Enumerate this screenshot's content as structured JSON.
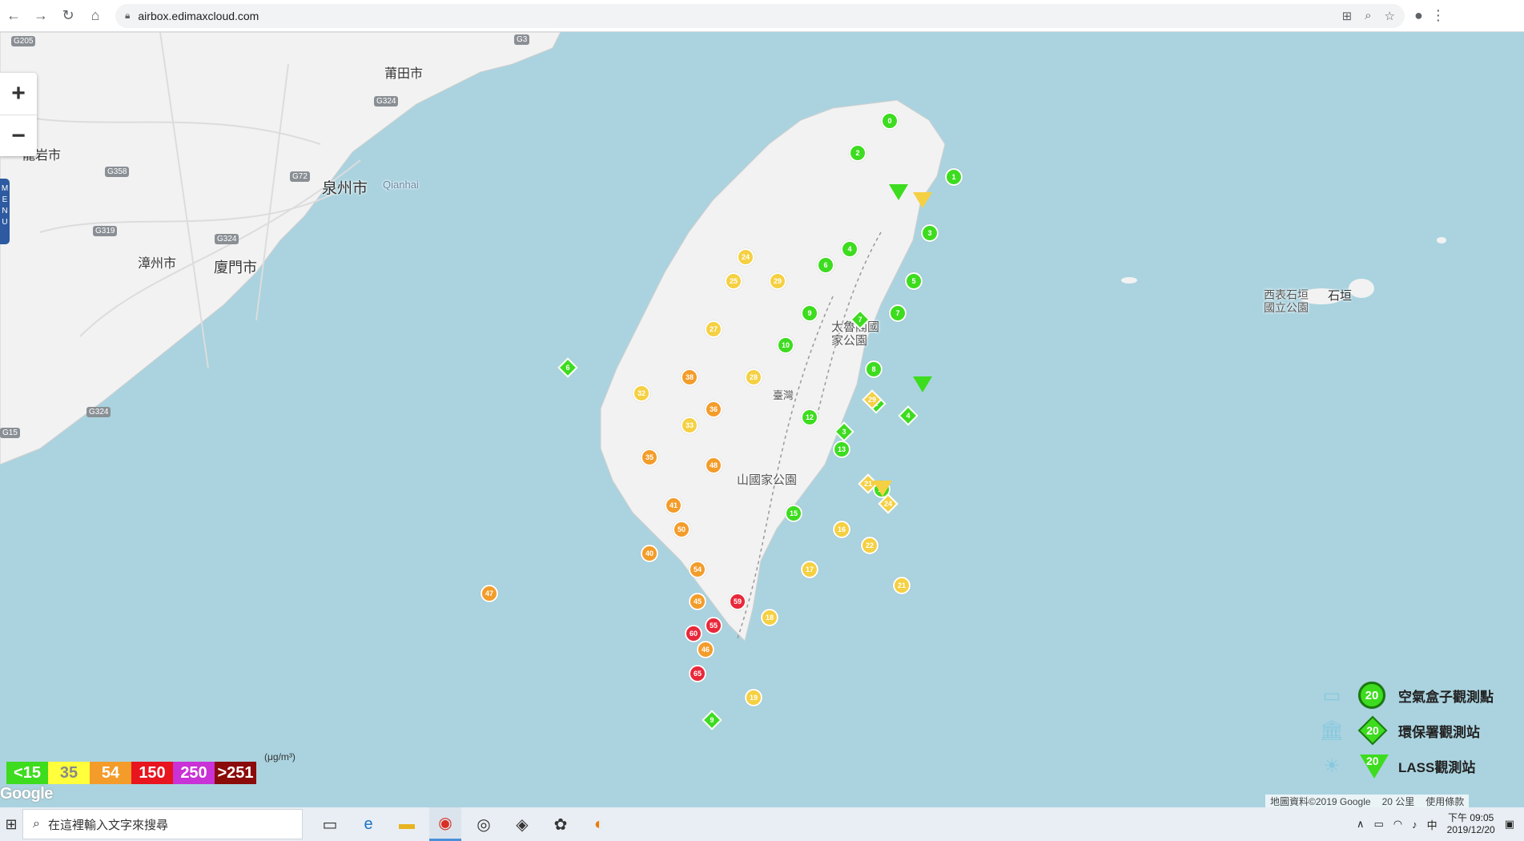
{
  "browser": {
    "url": "airbox.edimaxcloud.com",
    "icons": [
      "back-icon",
      "forward-icon",
      "reload-icon",
      "home-icon",
      "lock-icon",
      "translate-icon",
      "zoom-icon",
      "star-icon",
      "account-icon",
      "menu-icon"
    ]
  },
  "map": {
    "zoom_in": "+",
    "zoom_out": "−",
    "menu_tab": "MENU",
    "cities": [
      {
        "name": "莆田市"
      },
      {
        "name": "龍岩市"
      },
      {
        "name": "泉州市"
      },
      {
        "name": "Qianhai"
      },
      {
        "name": "漳州市"
      },
      {
        "name": "廈門市"
      },
      {
        "name": "太魯閣國家公園"
      },
      {
        "name": "山國家公園"
      },
      {
        "name": "臺灣"
      },
      {
        "name": "西表石垣國立公園"
      },
      {
        "name": "石垣"
      }
    ],
    "roads": [
      "G205",
      "G3",
      "G324",
      "G358",
      "G72",
      "G319",
      "G324",
      "G324",
      "G15"
    ],
    "markers": [
      {
        "t": "c",
        "v": "0",
        "c": "#3ddc1f"
      },
      {
        "t": "c",
        "v": "1",
        "c": "#3ddc1f"
      },
      {
        "t": "c",
        "v": "2",
        "c": "#3ddc1f"
      },
      {
        "t": "c",
        "v": "3",
        "c": "#3ddc1f"
      },
      {
        "t": "c",
        "v": "4",
        "c": "#3ddc1f"
      },
      {
        "t": "c",
        "v": "5",
        "c": "#3ddc1f"
      },
      {
        "t": "c",
        "v": "6",
        "c": "#3ddc1f"
      },
      {
        "t": "c",
        "v": "7",
        "c": "#3ddc1f"
      },
      {
        "t": "c",
        "v": "8",
        "c": "#3ddc1f"
      },
      {
        "t": "c",
        "v": "9",
        "c": "#3ddc1f"
      },
      {
        "t": "c",
        "v": "10",
        "c": "#3ddc1f"
      },
      {
        "t": "c",
        "v": "12",
        "c": "#3ddc1f"
      },
      {
        "t": "c",
        "v": "13",
        "c": "#3ddc1f"
      },
      {
        "t": "c",
        "v": "14",
        "c": "#3ddc1f"
      },
      {
        "t": "c",
        "v": "15",
        "c": "#3ddc1f"
      },
      {
        "t": "c",
        "v": "16",
        "c": "#f5d042"
      },
      {
        "t": "c",
        "v": "17",
        "c": "#f5d042"
      },
      {
        "t": "c",
        "v": "18",
        "c": "#f5d042"
      },
      {
        "t": "c",
        "v": "19",
        "c": "#f5d042"
      },
      {
        "t": "c",
        "v": "21",
        "c": "#f5d042"
      },
      {
        "t": "c",
        "v": "22",
        "c": "#f5d042"
      },
      {
        "t": "c",
        "v": "24",
        "c": "#f5d042"
      },
      {
        "t": "c",
        "v": "25",
        "c": "#f5d042"
      },
      {
        "t": "c",
        "v": "27",
        "c": "#f5d042"
      },
      {
        "t": "c",
        "v": "28",
        "c": "#f5d042"
      },
      {
        "t": "c",
        "v": "29",
        "c": "#f5d042"
      },
      {
        "t": "c",
        "v": "32",
        "c": "#f5d042"
      },
      {
        "t": "c",
        "v": "33",
        "c": "#f5d042"
      },
      {
        "t": "c",
        "v": "35",
        "c": "#f39c2a"
      },
      {
        "t": "c",
        "v": "36",
        "c": "#f39c2a"
      },
      {
        "t": "c",
        "v": "38",
        "c": "#f39c2a"
      },
      {
        "t": "c",
        "v": "40",
        "c": "#f39c2a"
      },
      {
        "t": "c",
        "v": "41",
        "c": "#f39c2a"
      },
      {
        "t": "c",
        "v": "45",
        "c": "#f39c2a"
      },
      {
        "t": "c",
        "v": "46",
        "c": "#f39c2a"
      },
      {
        "t": "c",
        "v": "47",
        "c": "#f39c2a"
      },
      {
        "t": "c",
        "v": "48",
        "c": "#f39c2a"
      },
      {
        "t": "c",
        "v": "50",
        "c": "#f39c2a"
      },
      {
        "t": "c",
        "v": "54",
        "c": "#f39c2a"
      },
      {
        "t": "c",
        "v": "55",
        "c": "#e8283a"
      },
      {
        "t": "c",
        "v": "59",
        "c": "#e8283a"
      },
      {
        "t": "c",
        "v": "60",
        "c": "#e8283a"
      },
      {
        "t": "c",
        "v": "65",
        "c": "#e8283a"
      },
      {
        "t": "d",
        "v": "9",
        "c": "#3ddc1f"
      },
      {
        "t": "d",
        "v": "3",
        "c": "#3ddc1f"
      },
      {
        "t": "d",
        "v": "4",
        "c": "#3ddc1f"
      },
      {
        "t": "d",
        "v": "2",
        "c": "#3ddc1f"
      },
      {
        "t": "d",
        "v": "6",
        "c": "#3ddc1f"
      },
      {
        "t": "d",
        "v": "7",
        "c": "#3ddc1f"
      },
      {
        "t": "d",
        "v": "21",
        "c": "#f5d042"
      },
      {
        "t": "d",
        "v": "24",
        "c": "#f5d042"
      },
      {
        "t": "d",
        "v": "29",
        "c": "#f5d042"
      },
      {
        "t": "v",
        "v": "",
        "c": "#3ddc1f"
      },
      {
        "t": "v",
        "v": "",
        "c": "#3ddc1f"
      },
      {
        "t": "v",
        "v": "",
        "c": "#f5d042"
      },
      {
        "t": "v",
        "v": "",
        "c": "#f5d042"
      }
    ]
  },
  "scale_legend": {
    "unit": "(μg/m³)",
    "items": [
      {
        "label": "<15",
        "color": "#3ddc1f"
      },
      {
        "label": "35",
        "color": "#ffff3b"
      },
      {
        "label": "54",
        "color": "#f39c2a"
      },
      {
        "label": "150",
        "color": "#e8141e"
      },
      {
        "label": "250",
        "color": "#c832d6"
      },
      {
        "label": ">251",
        "color": "#8b0a0a"
      }
    ]
  },
  "station_legend": {
    "items": [
      {
        "label": "空氣盒子觀測點",
        "value": "20",
        "shape": "circle",
        "icon": "airbox-icon"
      },
      {
        "label": "環保署觀測站",
        "value": "20",
        "shape": "diamond",
        "icon": "government-building-icon"
      },
      {
        "label": "LASS觀測站",
        "value": "20",
        "shape": "triangle",
        "icon": "sun-icon"
      }
    ]
  },
  "google_logo": "Google",
  "attribution": {
    "data": "地圖資料©2019 Google",
    "scale": "20 公里",
    "terms": "使用條款"
  },
  "taskbar": {
    "search_placeholder": "在這裡輸入文字來搜尋",
    "clock_time": "下午 09:05",
    "clock_date": "2019/12/20",
    "ime": "中",
    "notification_count": "1"
  }
}
